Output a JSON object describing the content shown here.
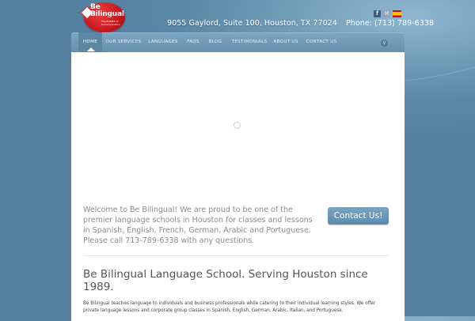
{
  "brand": {
    "name_line1": "Be",
    "name_line2": "Bilingual",
    "tagline": "The POWER of Communication"
  },
  "header": {
    "address": "9055 Gaylord, Suite 100, Houston, TX 77024",
    "phone": "Phone: (713) 789-6338"
  },
  "social": {
    "facebook": "f",
    "mail": "✉",
    "language_flag": ""
  },
  "nav": {
    "items": [
      {
        "label": "HOME"
      },
      {
        "label": "OUR SERVICES"
      },
      {
        "label": "LANGUAGES"
      },
      {
        "label": "FAQS"
      },
      {
        "label": "BLOG"
      },
      {
        "label": "TESTIMONIALS"
      },
      {
        "label": "ABOUT US"
      },
      {
        "label": "CONTACT US"
      }
    ],
    "search_icon": "⚲"
  },
  "main": {
    "welcome": "Welcome to Be Bilingual! We are proud to be one of the premier language schools in Houston for classes and lessons in Spanish, English, French, German, Arabic and Portuguese. Please call 713-789-6338 with any questions.",
    "contact_button": "Contact Us!",
    "headline": "Be Bilingual Language School. Serving Houston since 1989.",
    "body": "Be Bilingual teaches language to individuals and business professionals while catering to their individual learning styles. We offer private language lessons and corporate group classes in Spanish, English, German, Arabic, Italian, and Portuguese."
  },
  "colors": {
    "background": "#5b87a6",
    "nav": "#6790ad",
    "button": "#6b97b7",
    "logo_red": "#c8161e"
  }
}
